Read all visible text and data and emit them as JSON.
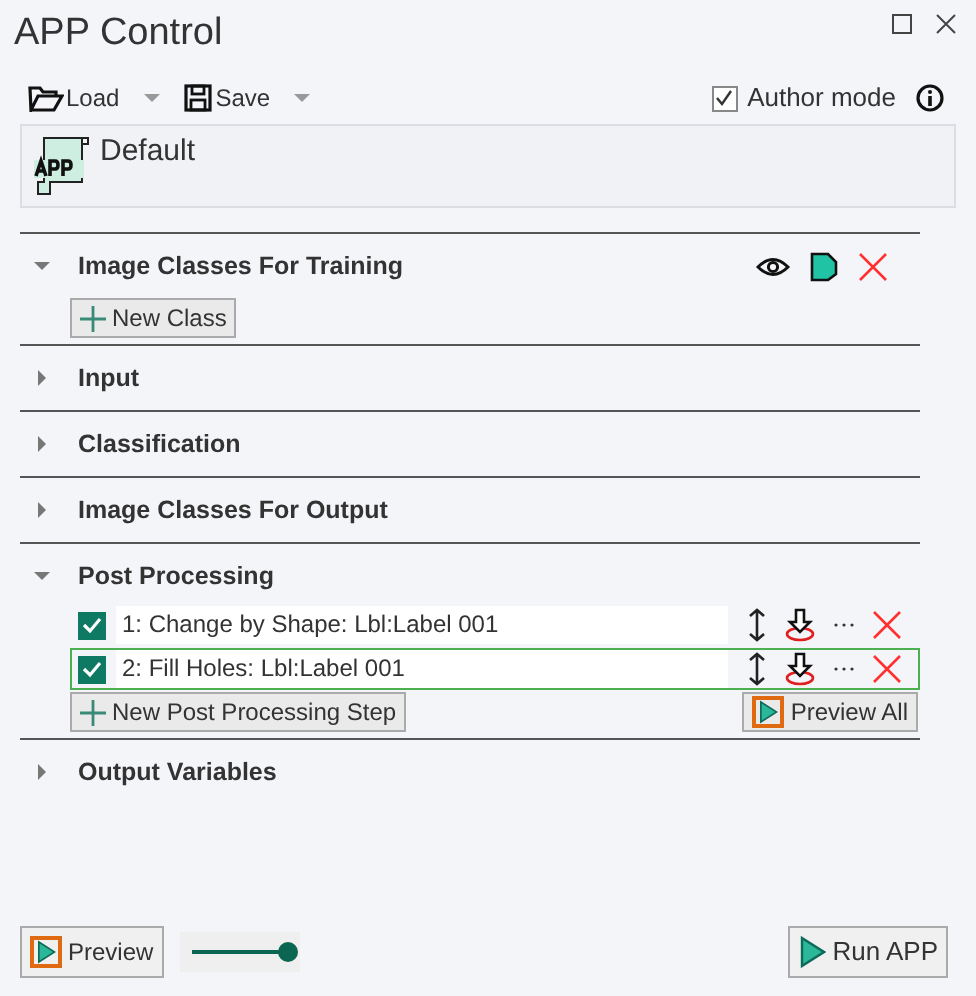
{
  "window": {
    "title": "APP Control"
  },
  "toolbar": {
    "load": "Load",
    "save": "Save",
    "author_mode": {
      "label": "Author mode",
      "checked": true
    }
  },
  "app": {
    "name": "Default"
  },
  "sections": [
    {
      "title": "Image Classes For Training",
      "expanded": true,
      "button": "New Class"
    },
    {
      "title": "Input",
      "expanded": false
    },
    {
      "title": "Classification",
      "expanded": false
    },
    {
      "title": "Image Classes For Output",
      "expanded": false
    },
    {
      "title": "Post Processing",
      "expanded": true,
      "button": "New Post Processing Step",
      "preview_button": "Preview All",
      "steps": [
        {
          "label": "1: Change by Shape: Lbl:Label 001",
          "checked": true,
          "selected": false
        },
        {
          "label": "2: Fill Holes: Lbl:Label 001",
          "checked": true,
          "selected": true
        }
      ]
    },
    {
      "title": "Output Variables",
      "expanded": false
    }
  ],
  "footer": {
    "preview": "Preview",
    "slider": {
      "level": 1
    },
    "run": "Run APP"
  }
}
